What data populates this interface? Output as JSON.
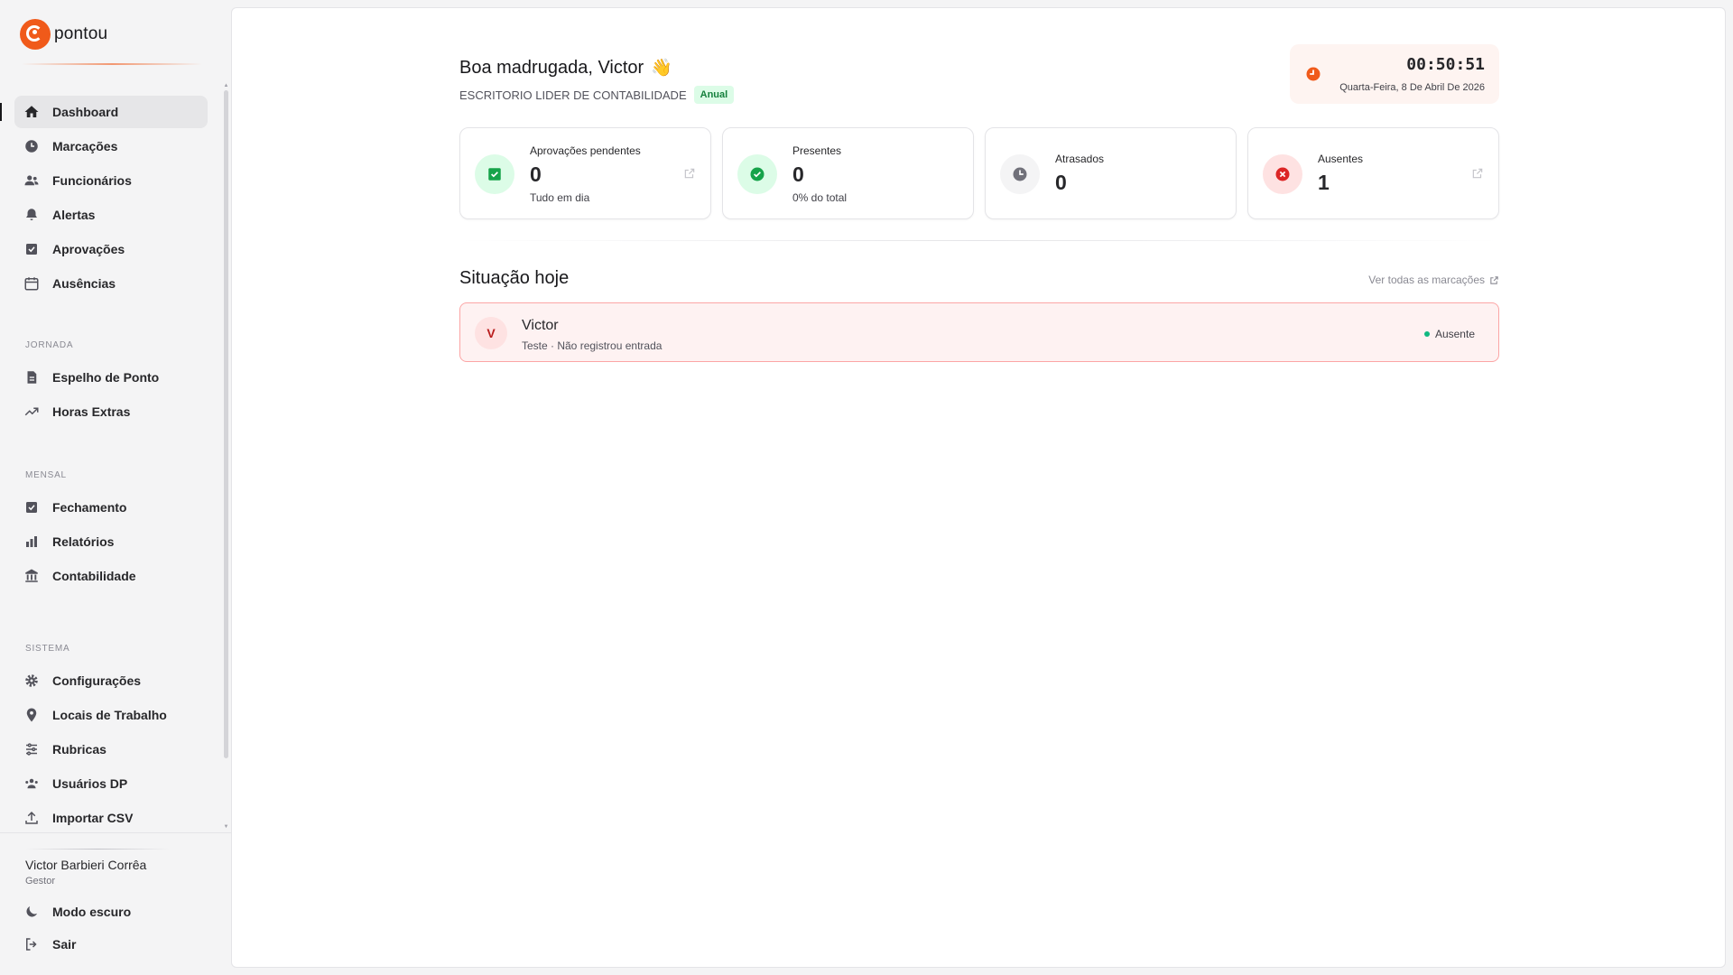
{
  "brand": {
    "name": "pontou",
    "accent": "#f05a1a"
  },
  "sidebar": {
    "items": [
      {
        "label": "Dashboard",
        "icon": "home-icon",
        "active": true
      },
      {
        "label": "Marcações",
        "icon": "clock-icon"
      },
      {
        "label": "Funcionários",
        "icon": "users-icon"
      },
      {
        "label": "Alertas",
        "icon": "bell-icon"
      },
      {
        "label": "Aprovações",
        "icon": "check-square-icon"
      },
      {
        "label": "Ausências",
        "icon": "calendar-icon"
      }
    ],
    "sections": [
      {
        "label": "JORNADA",
        "items": [
          {
            "label": "Espelho de Ponto",
            "icon": "document-icon"
          },
          {
            "label": "Horas Extras",
            "icon": "trending-up-icon"
          }
        ]
      },
      {
        "label": "MENSAL",
        "items": [
          {
            "label": "Fechamento",
            "icon": "check-square-icon"
          },
          {
            "label": "Relatórios",
            "icon": "bar-chart-icon"
          },
          {
            "label": "Contabilidade",
            "icon": "bank-icon"
          }
        ]
      },
      {
        "label": "SISTEMA",
        "items": [
          {
            "label": "Configurações",
            "icon": "gear-icon"
          },
          {
            "label": "Locais de Trabalho",
            "icon": "map-pin-icon"
          },
          {
            "label": "Rubricas",
            "icon": "sliders-icon"
          },
          {
            "label": "Usuários DP",
            "icon": "users-icon"
          },
          {
            "label": "Importar CSV",
            "icon": "upload-icon"
          }
        ]
      }
    ],
    "user": {
      "name": "Victor Barbieri Corrêa",
      "role": "Gestor"
    },
    "bottom_items": [
      {
        "label": "Modo escuro",
        "icon": "moon-icon"
      },
      {
        "label": "Sair",
        "icon": "logout-icon"
      }
    ]
  },
  "header": {
    "greeting": "Boa madrugada, Victor",
    "wave_emoji": "👋",
    "company": "ESCRITORIO LIDER DE CONTABILIDADE",
    "plan_badge": "Anual"
  },
  "clock": {
    "time": "00:50:51",
    "date": "Quarta-Feira, 8 De Abril De 2026",
    "accent": "#f05a1a"
  },
  "stats": [
    {
      "label": "Aprovações pendentes",
      "value": "0",
      "sub": "Tudo em dia",
      "icon": "check-square-icon",
      "icon_bg": "#dcfce7",
      "icon_color": "#16a34a",
      "external_link": true
    },
    {
      "label": "Presentes",
      "value": "0",
      "sub": "0% do total",
      "icon": "check-circle-icon",
      "icon_bg": "#dcfce7",
      "icon_color": "#16a34a",
      "external_link": false
    },
    {
      "label": "Atrasados",
      "value": "0",
      "sub": "",
      "icon": "clock-icon",
      "icon_bg": "#f4f4f5",
      "icon_color": "#71717a",
      "external_link": false
    },
    {
      "label": "Ausentes",
      "value": "1",
      "sub": "",
      "icon": "x-circle-icon",
      "icon_bg": "#fee2e2",
      "icon_color": "#dc2626",
      "external_link": true
    }
  ],
  "today": {
    "title": "Situação hoje",
    "see_all": "Ver todas as marcações",
    "rows": [
      {
        "initial": "V",
        "name": "Victor",
        "detail": "Teste · Não registrou entrada",
        "status": "Ausente",
        "status_color": "#10b981"
      }
    ]
  }
}
